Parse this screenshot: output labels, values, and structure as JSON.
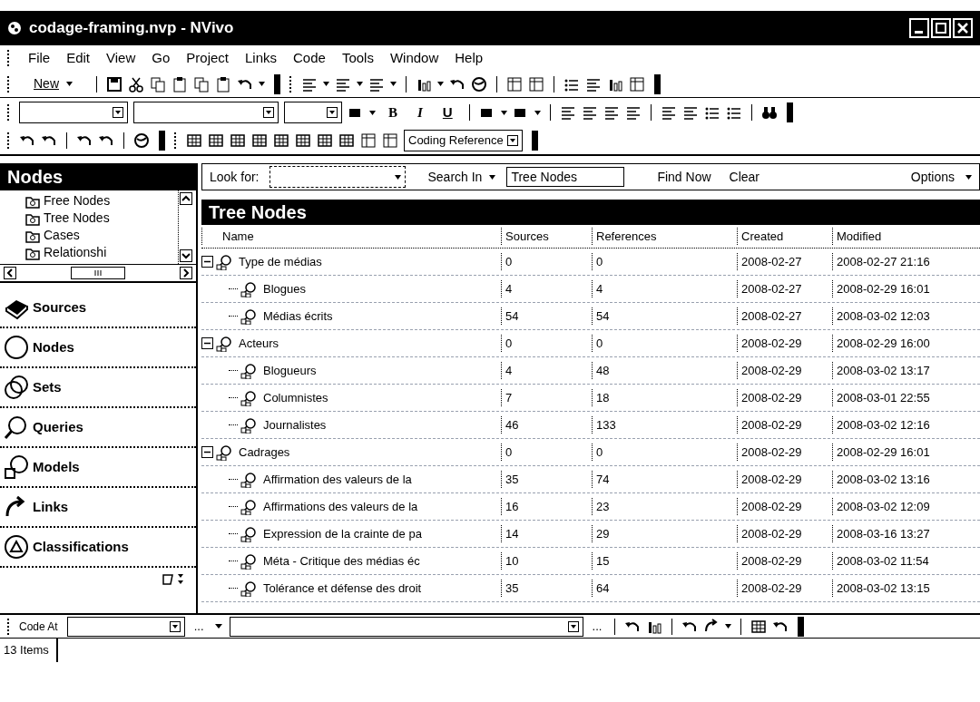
{
  "window": {
    "title": "codage-framing.nvp - NVivo"
  },
  "menu": [
    "File",
    "Edit",
    "View",
    "Go",
    "Project",
    "Links",
    "Code",
    "Tools",
    "Window",
    "Help"
  ],
  "toolbar": {
    "new_button": "New",
    "bold": "B",
    "italic": "I",
    "underline": "U",
    "coding_dropdown": "Coding Reference"
  },
  "navigation": {
    "title": "Nodes",
    "folders": [
      "Free Nodes",
      "Tree Nodes",
      "Cases",
      "Relationshi"
    ],
    "buttons": [
      "Sources",
      "Nodes",
      "Sets",
      "Queries",
      "Models",
      "Links",
      "Classifications"
    ]
  },
  "find_bar": {
    "look_for_label": "Look for:",
    "search_in": "Search In",
    "search_in_value": "Tree Nodes",
    "find_now": "Find Now",
    "clear": "Clear",
    "options": "Options"
  },
  "list": {
    "title": "Tree Nodes",
    "columns": [
      "Name",
      "Sources",
      "References",
      "Created",
      "Modified"
    ],
    "rows": [
      {
        "name": "Type de médias",
        "sources": "0",
        "references": "0",
        "created": "2008-02-27",
        "modified": "2008-02-27 21:16",
        "expanded": true,
        "children": [
          {
            "name": "Blogues",
            "sources": "4",
            "references": "4",
            "created": "2008-02-27",
            "modified": "2008-02-29 16:01"
          },
          {
            "name": "Médias écrits",
            "sources": "54",
            "references": "54",
            "created": "2008-02-27",
            "modified": "2008-03-02 12:03"
          }
        ]
      },
      {
        "name": "Acteurs",
        "sources": "0",
        "references": "0",
        "created": "2008-02-29",
        "modified": "2008-02-29 16:00",
        "expanded": true,
        "children": [
          {
            "name": "Blogueurs",
            "sources": "4",
            "references": "48",
            "created": "2008-02-29",
            "modified": "2008-03-02 13:17"
          },
          {
            "name": "Columnistes",
            "sources": "7",
            "references": "18",
            "created": "2008-02-29",
            "modified": "2008-03-01 22:55"
          },
          {
            "name": "Journalistes",
            "sources": "46",
            "references": "133",
            "created": "2008-02-29",
            "modified": "2008-03-02 12:16"
          }
        ]
      },
      {
        "name": "Cadrages",
        "sources": "0",
        "references": "0",
        "created": "2008-02-29",
        "modified": "2008-02-29 16:01",
        "expanded": true,
        "children": [
          {
            "name": "Affirmation des valeurs de la",
            "sources": "35",
            "references": "74",
            "created": "2008-02-29",
            "modified": "2008-03-02 13:16"
          },
          {
            "name": "Affirmations des valeurs de la",
            "sources": "16",
            "references": "23",
            "created": "2008-02-29",
            "modified": "2008-03-02 12:09"
          },
          {
            "name": "Expression de la crainte de pa",
            "sources": "14",
            "references": "29",
            "created": "2008-02-29",
            "modified": "2008-03-16 13:27"
          },
          {
            "name": "Méta - Critique des médias éc",
            "sources": "10",
            "references": "15",
            "created": "2008-02-29",
            "modified": "2008-03-02 11:54"
          },
          {
            "name": "Tolérance et défense des droit",
            "sources": "35",
            "references": "64",
            "created": "2008-02-29",
            "modified": "2008-03-02 13:15"
          }
        ]
      }
    ]
  },
  "coding_bar": {
    "label": "Code At",
    "browse_buttons": [
      "...",
      "..."
    ]
  },
  "status_bar": "13 Items"
}
